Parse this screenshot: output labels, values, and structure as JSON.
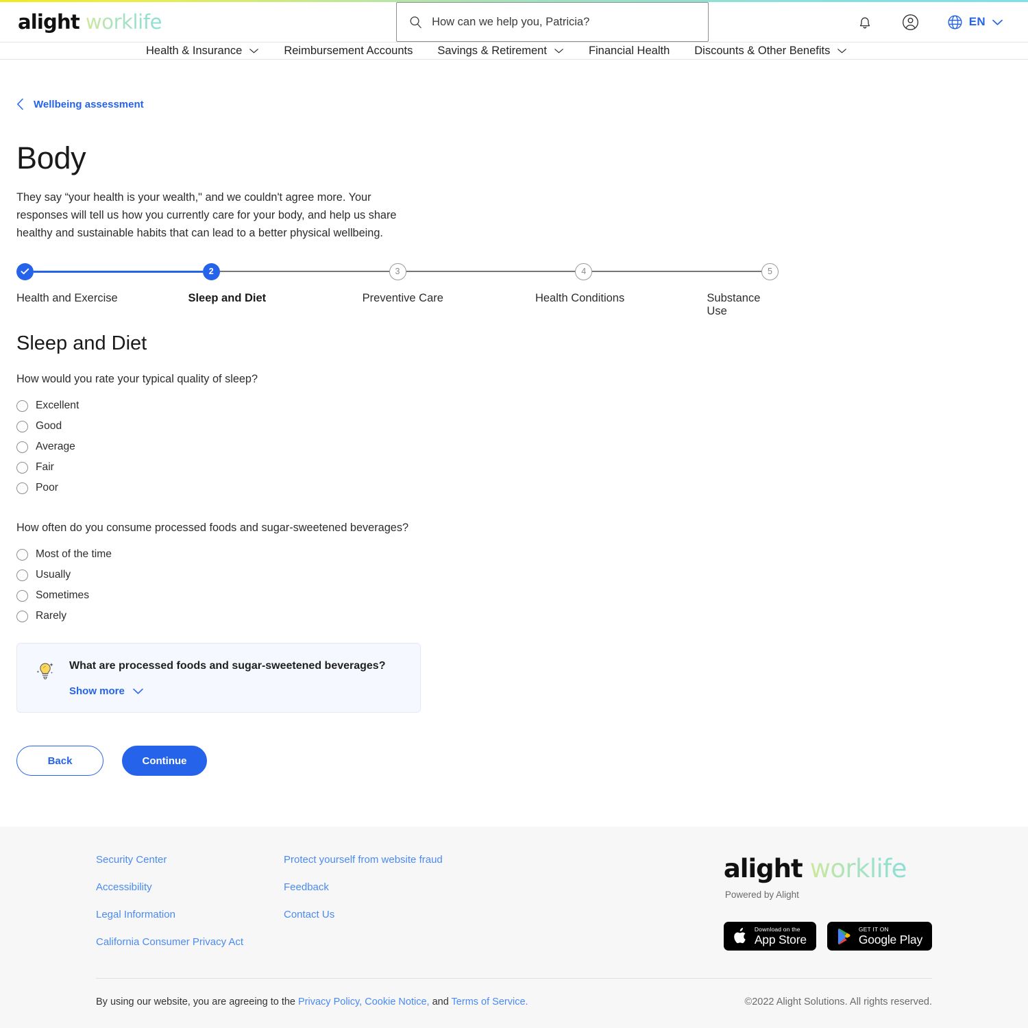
{
  "header": {
    "logo": {
      "primary": "alight",
      "secondary": "worklife"
    },
    "search": {
      "placeholder": "How can we help you, Patricia?",
      "value": ""
    },
    "notifications_icon": "bell-icon",
    "account_icon": "user-account-icon",
    "language": {
      "label": "EN",
      "icon": "globe-icon"
    }
  },
  "nav": {
    "items": [
      {
        "label": "Health & Insurance",
        "has_dropdown": true
      },
      {
        "label": "Reimbursement Accounts",
        "has_dropdown": false
      },
      {
        "label": "Savings & Retirement",
        "has_dropdown": true
      },
      {
        "label": "Financial Health",
        "has_dropdown": false
      },
      {
        "label": "Discounts & Other Benefits",
        "has_dropdown": true
      }
    ]
  },
  "breadcrumb": {
    "label": "Wellbeing assessment",
    "icon": "chevron-left-icon"
  },
  "page": {
    "title": "Body",
    "description": "They say “your health is your wealth,\" and we couldn't agree more. Your responses will tell us how you currently care for your body, and help us share healthy and sustainable habits that can lead to a better physical wellbeing."
  },
  "stepper": {
    "steps": [
      {
        "number": "1",
        "label": "Health and Exercise",
        "state": "done"
      },
      {
        "number": "2",
        "label": "Sleep and Diet",
        "state": "active"
      },
      {
        "number": "3",
        "label": "Preventive Care",
        "state": "todo"
      },
      {
        "number": "4",
        "label": "Health Conditions",
        "state": "todo"
      },
      {
        "number": "5",
        "label": "Substance Use",
        "state": "todo"
      }
    ]
  },
  "form": {
    "section_title": "Sleep and Diet",
    "questions": [
      {
        "text": "How would you rate your typical quality of sleep?",
        "options": [
          "Excellent",
          "Good",
          "Average",
          "Fair",
          "Poor"
        ],
        "selected": null
      },
      {
        "text": "How often do you consume processed foods and sugar-sweetened beverages?",
        "options": [
          "Most of the time",
          "Usually",
          "Sometimes",
          "Rarely"
        ],
        "selected": null
      }
    ],
    "tip": {
      "icon": "lightbulb-icon",
      "title": "What are processed foods and sugar-sweetened beverages?",
      "show_more_label": "Show more",
      "chevron_icon": "chevron-down-icon"
    },
    "buttons": {
      "back": "Back",
      "continue": "Continue"
    }
  },
  "footer": {
    "column_one": [
      "Security Center",
      "Accessibility",
      "Legal Information",
      "California Consumer Privacy Act"
    ],
    "column_two": [
      "Protect yourself from website fraud",
      "Feedback",
      "Contact Us"
    ],
    "logo": {
      "primary": "alight",
      "secondary": "worklife"
    },
    "powered_by": "Powered by Alight",
    "badges": [
      {
        "icon": "apple-icon",
        "small": "Download on the",
        "big": "App Store"
      },
      {
        "icon": "google-play-icon",
        "small": "GET IT ON",
        "big": "Google Play"
      }
    ],
    "legal": {
      "prefix": "By using our website, you are agreeing to the ",
      "privacy": "Privacy Policy,",
      "cookie": "Cookie Notice,",
      "and": " and ",
      "terms": "Terms of Service."
    },
    "copyright": "©2022 Alight Solutions. All rights reserved."
  },
  "colors": {
    "accent_blue": "#2563eb",
    "link_blue": "#4a8af4",
    "tip_bg": "#f5f8fe",
    "footer_bg": "#f7f7f7"
  }
}
